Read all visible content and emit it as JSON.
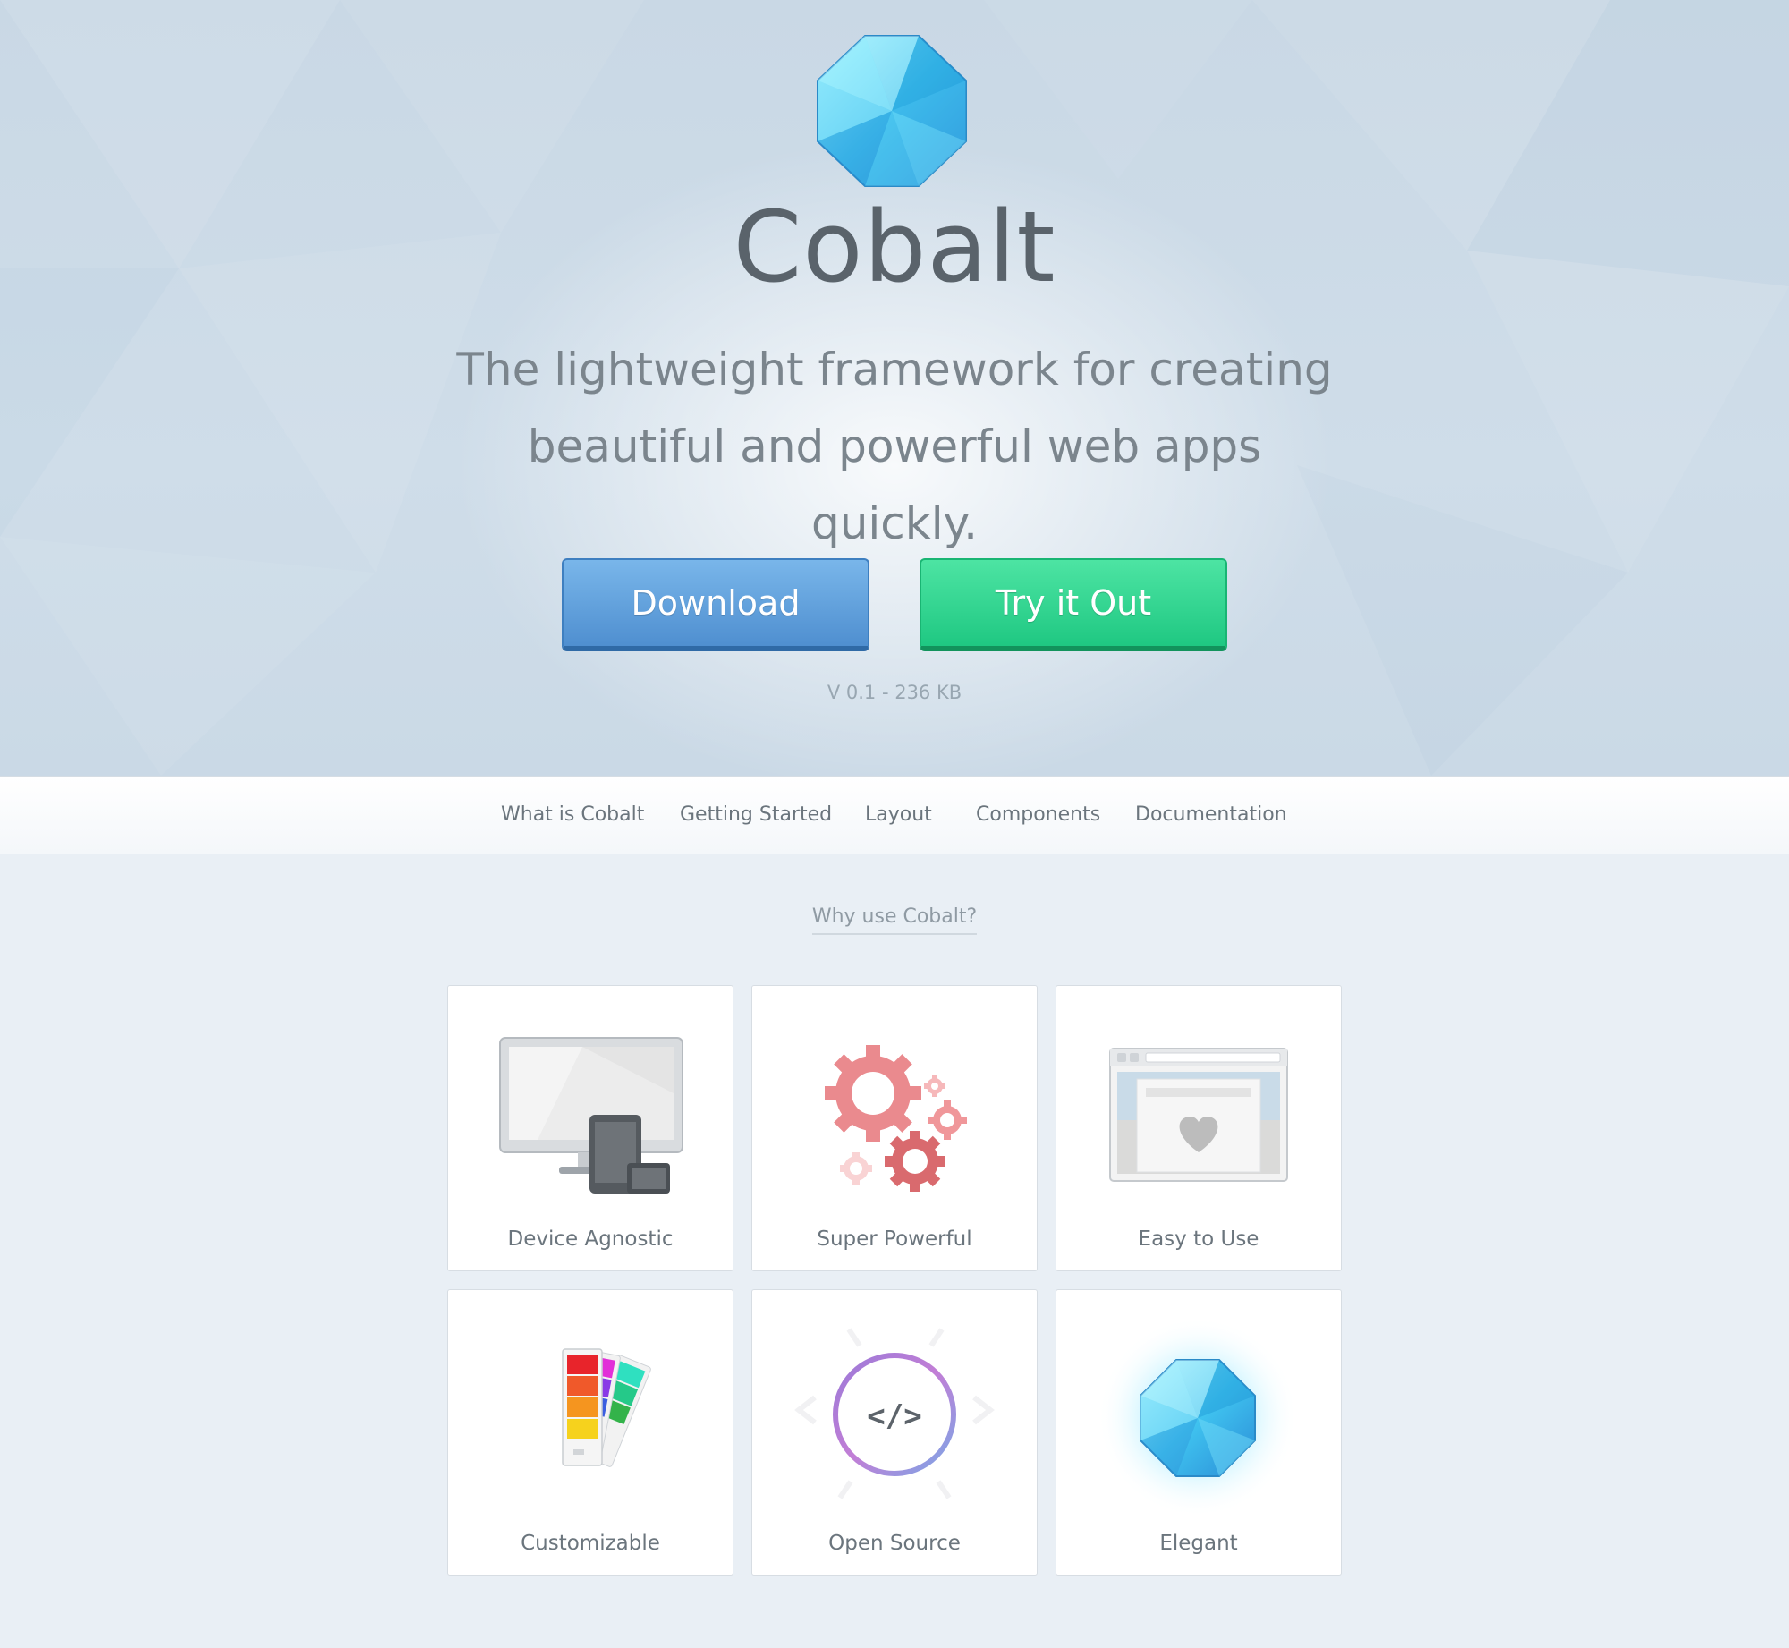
{
  "hero": {
    "logo_icon": "cobalt-gem-icon",
    "title": "Cobalt",
    "tagline_line1": "The lightweight framework for creating",
    "tagline_line2": "beautiful and powerful web apps quickly.",
    "download_label": "Download",
    "try_label": "Try it Out",
    "version": "V 0.1 - 236 KB"
  },
  "nav": {
    "items": [
      "What is Cobalt",
      "Getting Started",
      "Layout",
      "Components",
      "Documentation"
    ]
  },
  "features": {
    "heading": "Why use Cobalt?",
    "cards": [
      {
        "label": "Device Agnostic",
        "icon": "devices-icon"
      },
      {
        "label": "Super Powerful",
        "icon": "gears-icon"
      },
      {
        "label": "Easy to Use",
        "icon": "browser-heart-icon"
      },
      {
        "label": "Customizable",
        "icon": "color-swatches-icon"
      },
      {
        "label": "Open Source",
        "icon": "code-circle-icon"
      },
      {
        "label": "Elegant",
        "icon": "glowing-gem-icon"
      }
    ]
  },
  "colors": {
    "download_button": "#5b9ad9",
    "try_button": "#2dd18e",
    "background": "#e9eff5"
  }
}
